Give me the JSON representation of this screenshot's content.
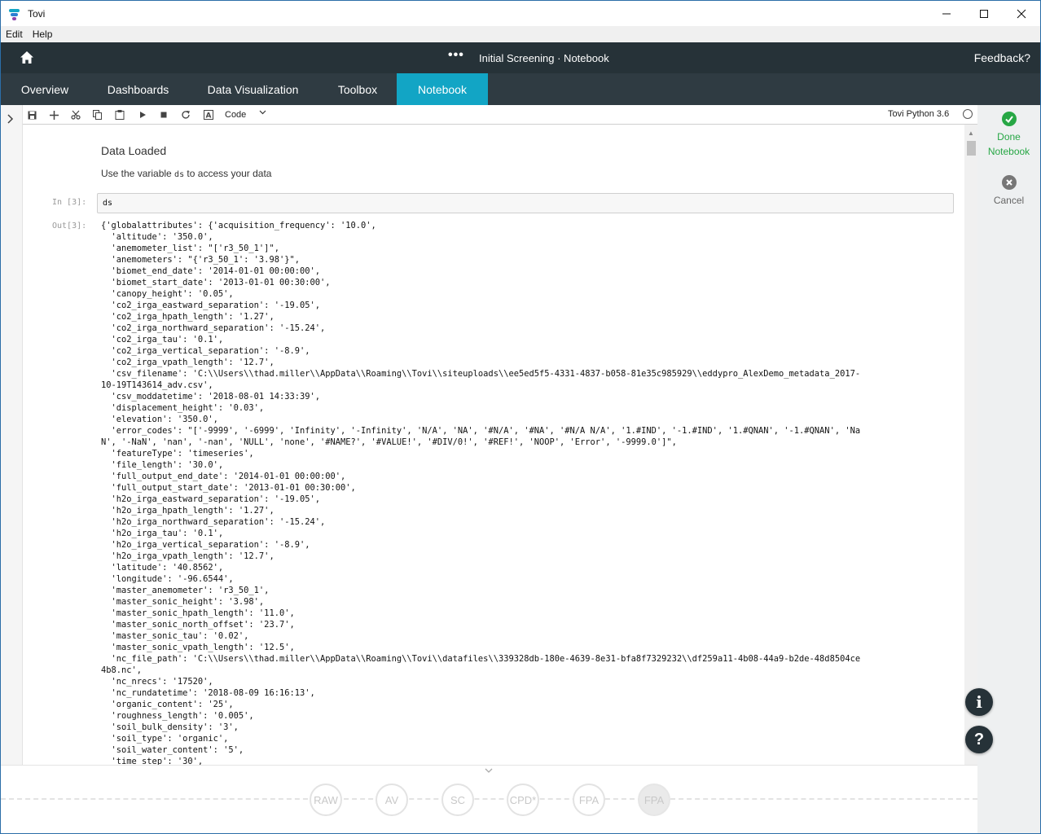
{
  "window": {
    "title": "Tovi"
  },
  "menu": {
    "items": [
      "Edit",
      "Help"
    ]
  },
  "header": {
    "title": "Initial Screening · Notebook",
    "more": "•••",
    "feedback": "Feedback?"
  },
  "tabs": [
    {
      "label": "Overview"
    },
    {
      "label": "Dashboards"
    },
    {
      "label": "Data Visualization"
    },
    {
      "label": "Toolbox"
    },
    {
      "label": "Notebook",
      "active": true
    }
  ],
  "toolbar": {
    "cell_type": "Code",
    "kernel": "Tovi Python 3.6"
  },
  "notebook": {
    "markdown_title": "Data Loaded",
    "markdown_text_before": "Use the variable ",
    "markdown_code": "ds",
    "markdown_text_after": " to access your data",
    "in_prompt": "In [3]:",
    "in_code": "ds",
    "out_prompt": "Out[3]:",
    "output_lines": [
      "{'globalattributes': {'acquisition_frequency': '10.0',",
      "  'altitude': '350.0',",
      "  'anemometer_list': \"['r3_50_1']\",",
      "  'anemometers': \"{'r3_50_1': '3.98'}\",",
      "  'biomet_end_date': '2014-01-01 00:00:00',",
      "  'biomet_start_date': '2013-01-01 00:30:00',",
      "  'canopy_height': '0.05',",
      "  'co2_irga_eastward_separation': '-19.05',",
      "  'co2_irga_hpath_length': '1.27',",
      "  'co2_irga_northward_separation': '-15.24',",
      "  'co2_irga_tau': '0.1',",
      "  'co2_irga_vertical_separation': '-8.9',",
      "  'co2_irga_vpath_length': '12.7',",
      "  'csv_filename': 'C:\\\\Users\\\\thad.miller\\\\AppData\\\\Roaming\\\\Tovi\\\\siteuploads\\\\ee5ed5f5-4331-4837-b058-81e35c985929\\\\eddypro_AlexDemo_metadata_2017-",
      "10-19T143614_adv.csv',",
      "  'csv_moddatetime': '2018-08-01 14:33:39',",
      "  'displacement_height': '0.03',",
      "  'elevation': '350.0',",
      "  'error_codes': \"['-9999', '-6999', 'Infinity', '-Infinity', 'N/A', 'NA', '#N/A', '#NA', '#N/A N/A', '1.#IND', '-1.#IND', '1.#QNAN', '-1.#QNAN', 'Na",
      "N', '-NaN', 'nan', '-nan', 'NULL', 'none', '#NAME?', '#VALUE!', '#DIV/0!', '#REF!', 'NOOP', 'Error', '-9999.0']\",",
      "  'featureType': 'timeseries',",
      "  'file_length': '30.0',",
      "  'full_output_end_date': '2014-01-01 00:00:00',",
      "  'full_output_start_date': '2013-01-01 00:30:00',",
      "  'h2o_irga_eastward_separation': '-19.05',",
      "  'h2o_irga_hpath_length': '1.27',",
      "  'h2o_irga_northward_separation': '-15.24',",
      "  'h2o_irga_tau': '0.1',",
      "  'h2o_irga_vertical_separation': '-8.9',",
      "  'h2o_irga_vpath_length': '12.7',",
      "  'latitude': '40.8562',",
      "  'longitude': '-96.6544',",
      "  'master_anemometer': 'r3_50_1',",
      "  'master_sonic_height': '3.98',",
      "  'master_sonic_hpath_length': '11.0',",
      "  'master_sonic_north_offset': '23.7',",
      "  'master_sonic_tau': '0.02',",
      "  'master_sonic_vpath_length': '12.5',",
      "  'nc_file_path': 'C:\\\\Users\\\\thad.miller\\\\AppData\\\\Roaming\\\\Tovi\\\\datafiles\\\\339328db-180e-4639-8e31-bfa8f7329232\\\\df259a11-4b08-44a9-b2de-48d8504ce",
      "4b8.nc',",
      "  'nc_nrecs': '17520',",
      "  'nc_rundatetime': '2018-08-09 16:16:13',",
      "  'organic_content': '25',",
      "  'roughness_length': '0.005',",
      "  'soil_bulk_density': '3',",
      "  'soil_type': 'organic',",
      "  'soil_water_content': '5',",
      "  'time_step': '30',"
    ]
  },
  "right_panel": {
    "done_line1": "Done",
    "done_line2": "Notebook",
    "cancel": "Cancel",
    "info": "i",
    "help": "?"
  },
  "workflow": {
    "steps": [
      "RAW",
      "AV",
      "SC",
      "CPD*",
      "FPA",
      "FPA"
    ]
  },
  "colors": {
    "header": "#263238",
    "tabs": "#2f3b42",
    "active_tab": "#12a5c5",
    "done": "#27a745"
  }
}
